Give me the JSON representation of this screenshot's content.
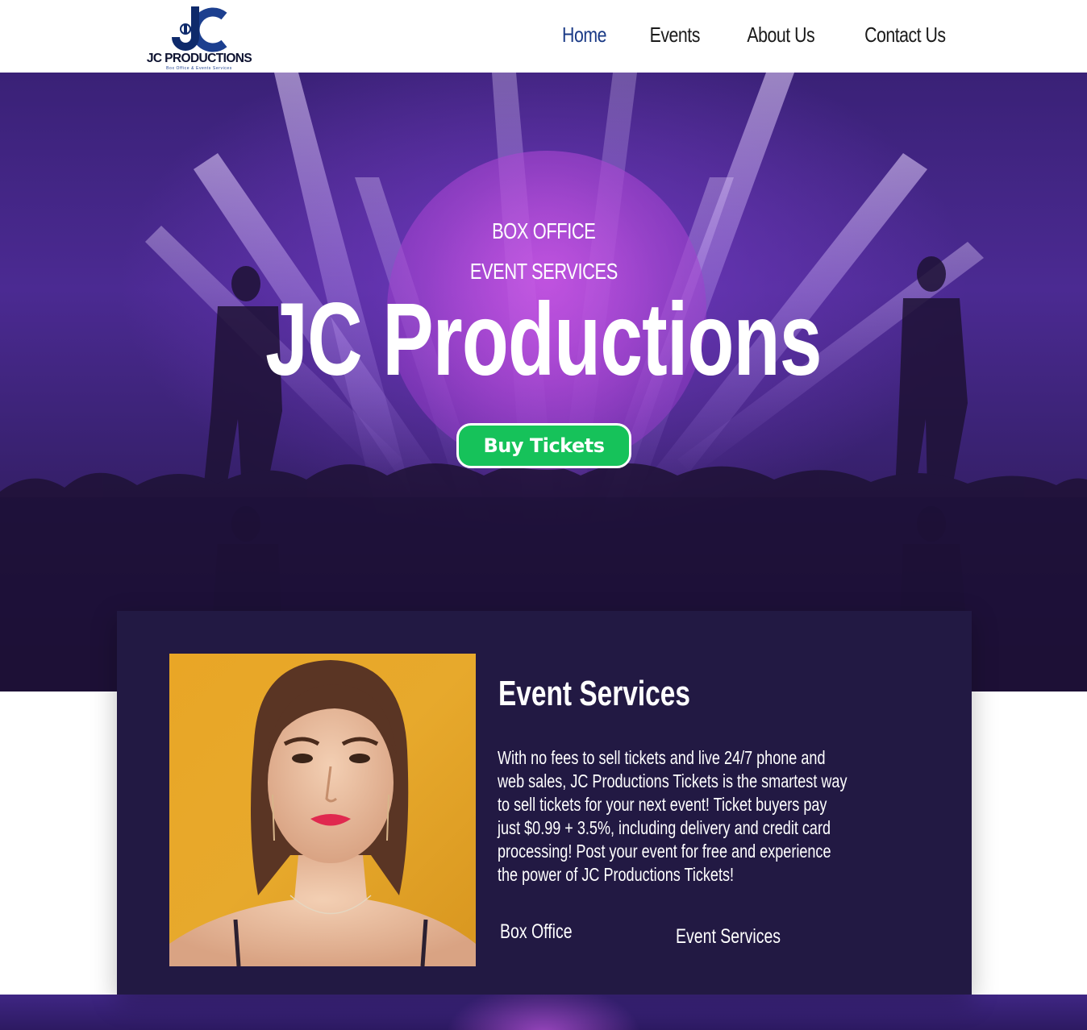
{
  "brand": {
    "logo_initials": "JC",
    "logo_name": "JC PRODUCTIONS",
    "logo_tagline": "Box Office & Events Services",
    "colors": {
      "navy": "#1a3a86",
      "dark_text": "#1b1b1b"
    }
  },
  "nav": {
    "items": [
      {
        "label": "Home",
        "active": true
      },
      {
        "label": "Events",
        "active": false
      },
      {
        "label": "About Us",
        "active": false
      },
      {
        "label": "Contact Us",
        "active": false
      }
    ]
  },
  "hero": {
    "eyebrow_1": "BOX OFFICE",
    "eyebrow_2": "EVENT SERVICES",
    "title": "JC Productions",
    "cta_label": "Buy Tickets",
    "colors": {
      "cta": "#16c25a",
      "overlay": "#3a2177"
    }
  },
  "card": {
    "heading": "Event Services",
    "body": "With no fees to sell tickets and live 24/7 phone and web sales, JC Productions Tickets is the smartest way to sell tickets for your next event! Ticket buyers pay just $0.99 + 3.5%, including delivery and credit card processing! Post your event for free and experience the power of JC Productions Tickets!",
    "links": [
      {
        "label": "Box Office"
      },
      {
        "label": "Event Services"
      }
    ],
    "colors": {
      "background": "#221943"
    }
  }
}
